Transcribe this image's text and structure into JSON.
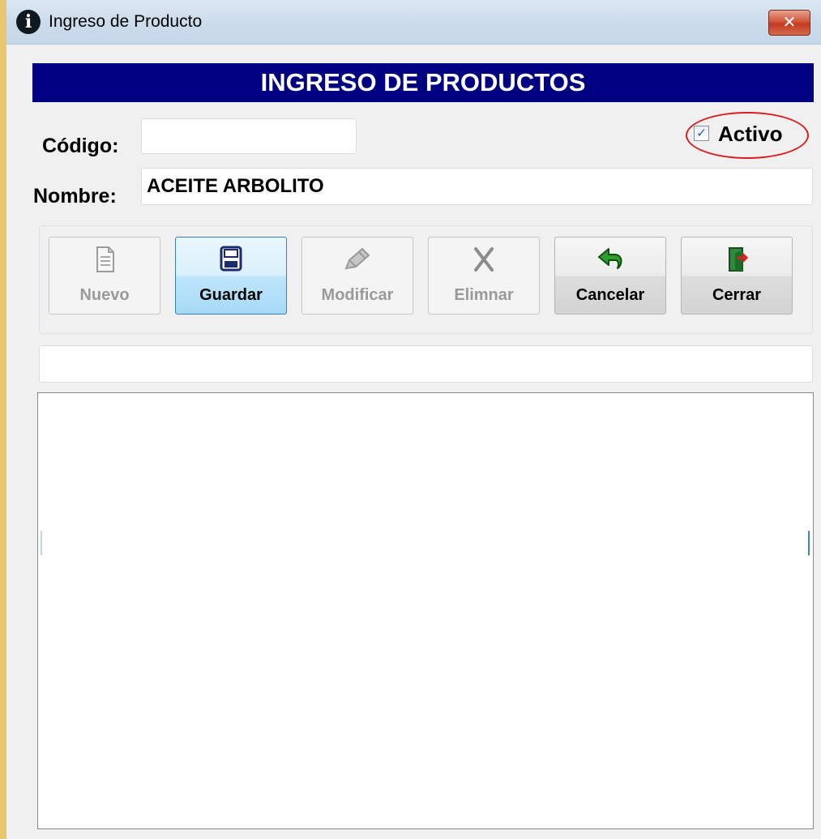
{
  "window": {
    "title": "Ingreso de Producto",
    "title_icon": "info-icon",
    "close_icon": "close-icon"
  },
  "header": {
    "banner": "INGRESO DE PRODUCTOS",
    "banner_color": "#000080"
  },
  "form": {
    "codigo_label": "Código:",
    "codigo_value": "",
    "nombre_label": "Nombre:",
    "nombre_value": "ACEITE ARBOLITO",
    "activo_label": "Activo",
    "activo_checked": true,
    "highlight_color": "#d81e1e"
  },
  "toolbar": {
    "buttons": [
      {
        "label": "Nuevo",
        "icon": "document-icon",
        "enabled": false
      },
      {
        "label": "Guardar",
        "icon": "floppy-disk-icon",
        "enabled": true,
        "focused": true
      },
      {
        "label": "Modificar",
        "icon": "pencil-icon",
        "enabled": false
      },
      {
        "label": "Elimnar",
        "icon": "delete-x-icon",
        "enabled": false
      },
      {
        "label": "Cancelar",
        "icon": "undo-arrow-icon",
        "enabled": true
      },
      {
        "label": "Cerrar",
        "icon": "exit-door-icon",
        "enabled": true
      }
    ]
  },
  "status": {
    "text": ""
  }
}
